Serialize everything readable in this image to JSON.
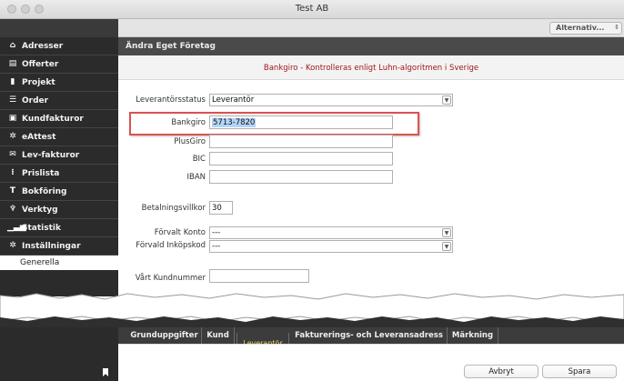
{
  "window": {
    "title": "Test AB"
  },
  "toolbar": {
    "alternativ_label": "Alternativ..."
  },
  "sidebar": {
    "items": [
      {
        "label": "Adresser",
        "icon": "home-icon"
      },
      {
        "label": "Offerter",
        "icon": "document-icon"
      },
      {
        "label": "Projekt",
        "icon": "folder-icon"
      },
      {
        "label": "Order",
        "icon": "list-icon"
      },
      {
        "label": "Kundfakturor",
        "icon": "invoice-icon"
      },
      {
        "label": "eAttest",
        "icon": "gear-icon"
      },
      {
        "label": "Lev-fakturor",
        "icon": "mail-icon"
      },
      {
        "label": "Prislista",
        "icon": "pricelist-icon"
      },
      {
        "label": "Bokföring",
        "icon": "ledger-icon"
      },
      {
        "label": "Verktyg",
        "icon": "tools-icon"
      },
      {
        "label": "Statistik",
        "icon": "chart-icon"
      },
      {
        "label": "Inställningar",
        "icon": "settings-icon"
      }
    ],
    "sub_item": "Generella"
  },
  "main": {
    "header": "Ändra Eget Företag",
    "notice": "Bankgiro - Kontrolleras enligt Luhn-algoritmen i Sverige"
  },
  "form": {
    "leverantorsstatus": {
      "label": "Leverantörsstatus",
      "value": "Leverantör"
    },
    "bankgiro": {
      "label": "Bankgiro",
      "value": "5713-7820"
    },
    "plusgiro": {
      "label": "PlusGiro",
      "value": ""
    },
    "bic": {
      "label": "BIC",
      "value": ""
    },
    "iban": {
      "label": "IBAN",
      "value": ""
    },
    "betalningsvillkor": {
      "label": "Betalningsvillkor",
      "value": "30"
    },
    "forvalt_konto": {
      "label": "Förvalt Konto",
      "value": "---"
    },
    "forvald_inkopskod": {
      "label": "Förvald Inköpskod",
      "value": "---"
    },
    "vart_kundnummer": {
      "label": "Vårt Kundnummer",
      "value": ""
    }
  },
  "tabs": [
    {
      "label": "Grunduppgifter"
    },
    {
      "label": "Kund"
    },
    {
      "label": "Leverantör"
    },
    {
      "label": "Fakturerings- och Leveransadress"
    },
    {
      "label": "Märkning"
    }
  ],
  "footer": {
    "cancel_label": "Avbryt",
    "save_label": "Spara"
  },
  "colors": {
    "highlight": "#d9534f",
    "notice_text": "#a01818",
    "active_tab_text": "#f1d35a"
  }
}
